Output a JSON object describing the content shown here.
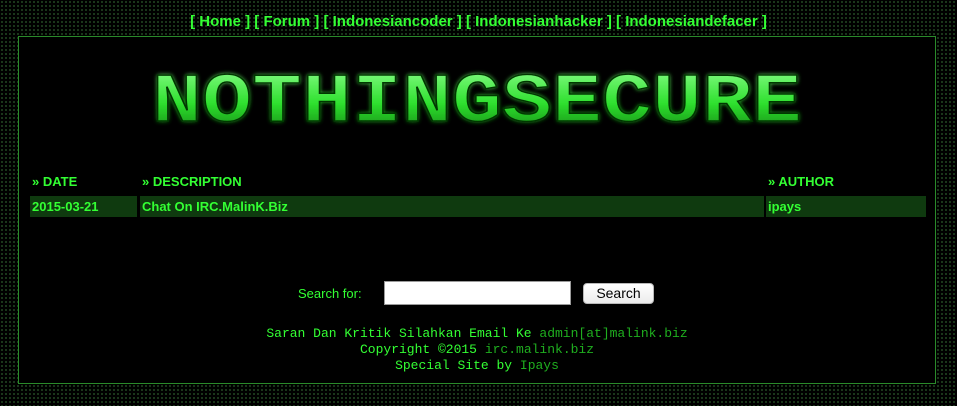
{
  "nav": {
    "items": [
      {
        "label": "Home"
      },
      {
        "label": "Forum"
      },
      {
        "label": "Indonesiancoder"
      },
      {
        "label": "Indonesianhacker"
      },
      {
        "label": "Indonesiandefacer"
      }
    ]
  },
  "logo": {
    "text": "NOTHINGSECURE"
  },
  "table": {
    "headers": {
      "date": "» DATE",
      "description": "» DESCRIPTION",
      "author": "» AUTHOR"
    },
    "rows": [
      {
        "date": "2015-03-21",
        "description": "Chat On IRC.MalinK.Biz",
        "author": "ipays"
      }
    ]
  },
  "search": {
    "label": "Search for:",
    "value": "",
    "button_label": "Search"
  },
  "footer": {
    "line1_text": "Saran Dan Kritik Silahkan Email Ke",
    "line1_link": "admin[at]malink.biz",
    "line2_text": "Copyright ©2015",
    "line2_link": "irc.malink.biz",
    "line3_text": "Special Site by",
    "line3_link": "Ipays"
  },
  "colors": {
    "background": "#000000",
    "text": "#33ff33",
    "row_background": "#0f3a0f",
    "frame_border": "#2a8a2a"
  }
}
